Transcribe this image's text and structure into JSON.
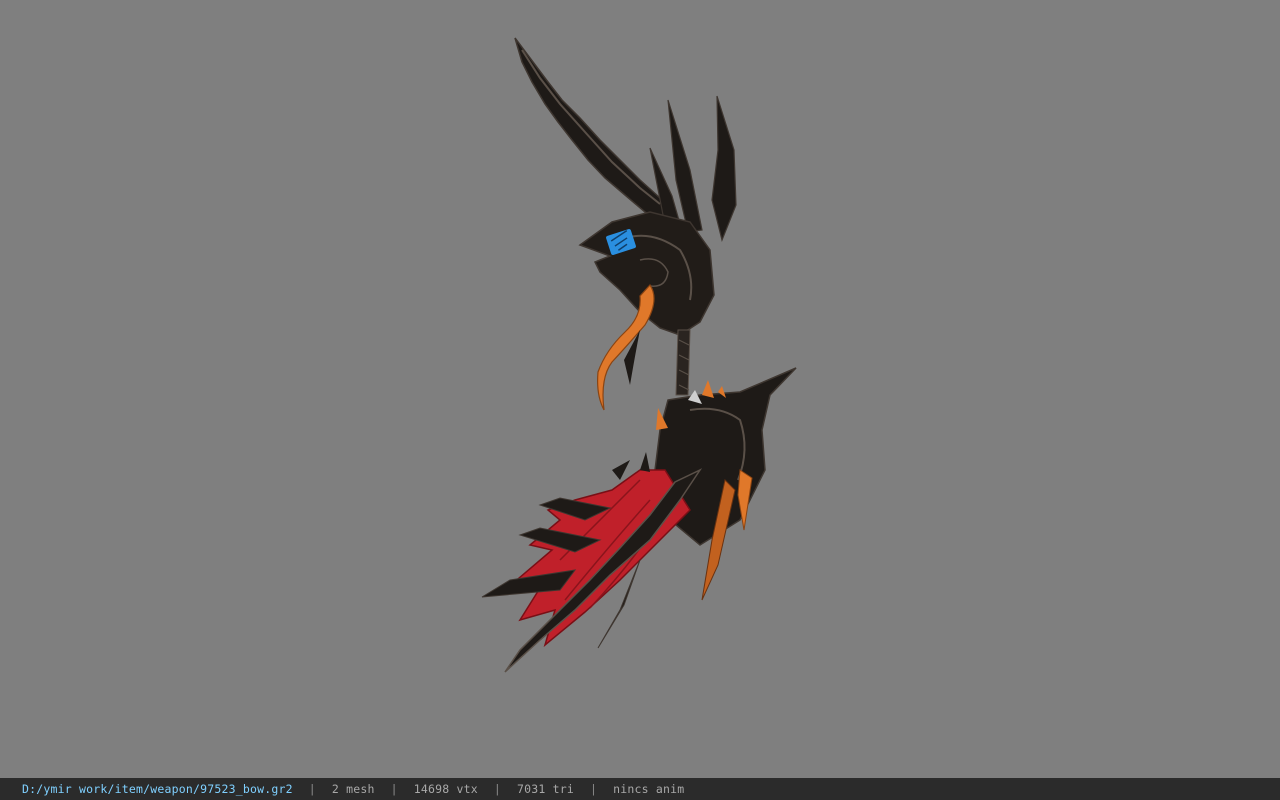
{
  "viewport": {
    "background": "#7f7f7f",
    "model_colors": {
      "metal": "#1e1a17",
      "metal_highlight": "#5a5048",
      "membrane": "#c0202a",
      "membrane_dark": "#7a0f16",
      "accent_orange": "#e0782a",
      "rune_blue": "#2a8fe0"
    }
  },
  "status_bar": {
    "file_path": "D:/ymir work/item/weapon/97523_bow.gr2",
    "separator": "|",
    "mesh_count": "2 mesh",
    "vertex_count": "14698 vtx",
    "triangle_count": "7031 tri",
    "animation_status": "nincs anim"
  }
}
